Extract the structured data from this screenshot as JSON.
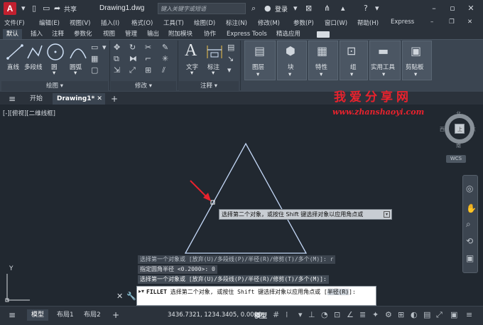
{
  "titlebar": {
    "app_letter": "A",
    "share": "共享",
    "doc_title": "Drawing1.dwg",
    "search_placeholder": "键入关键字或短语",
    "login": "登录"
  },
  "menus": [
    "文件(F)",
    "编辑(E)",
    "视图(V)",
    "插入(I)",
    "格式(O)",
    "工具(T)",
    "绘图(D)",
    "标注(N)",
    "修改(M)",
    "参数(P)",
    "窗口(W)",
    "帮助(H)",
    "Express"
  ],
  "ribbon_tabs": [
    "默认",
    "插入",
    "注释",
    "参数化",
    "视图",
    "管理",
    "输出",
    "附加模块",
    "协作",
    "Express Tools",
    "精选应用"
  ],
  "ribbon": {
    "draw_tools": [
      "直线",
      "多段线",
      "圆",
      "圆弧"
    ],
    "panel_draw": "绘图",
    "panel_modify": "修改",
    "text_tools": [
      "文字",
      "标注"
    ],
    "panel_annotation": "注释",
    "big_tools": [
      "图层",
      "块",
      "特性",
      "组",
      "实用工具",
      "剪贴板"
    ]
  },
  "file_tabs": {
    "start": "开始",
    "drawing": "Drawing1*"
  },
  "canvas": {
    "view_label": "[-][俯视][二维线框]",
    "watermark_title": "我爱分享网",
    "watermark_url": "www.zhanshaoyi.com",
    "compass": {
      "n": "北",
      "s": "南",
      "e": "东",
      "w": "西"
    },
    "cube_face": "上",
    "wcs": "WCS",
    "tooltip": "选择第二个对象，或按住 Shift 键选择对象以应用角点或",
    "ucs_y": "Y"
  },
  "command": {
    "history": [
      "选择第一个对象或 [放弃(U)/多段线(P)/半径(R)/修剪(T)/多个(M)]: r",
      "指定圆角半径 <0.2000>: 0",
      "选择第一个对象或 [放弃(U)/多段线(P)/半径(R)/修剪(T)/多个(M)]:"
    ],
    "prompt_cmd": "FILLET",
    "prompt_text": "选择第二个对象, 或按住 Shift 键选择对象以应用角点或 [",
    "prompt_key": "半径(R)",
    "prompt_end": "]:"
  },
  "statusbar": {
    "tabs": [
      "模型",
      "布局1",
      "布局2"
    ],
    "coords": "3436.7321, 1234.3405, 0.0000",
    "model": "模型"
  },
  "colors": {
    "triangle": "#c3d7f6",
    "arrow": "#e8222d",
    "watermark": "#e8222d"
  }
}
